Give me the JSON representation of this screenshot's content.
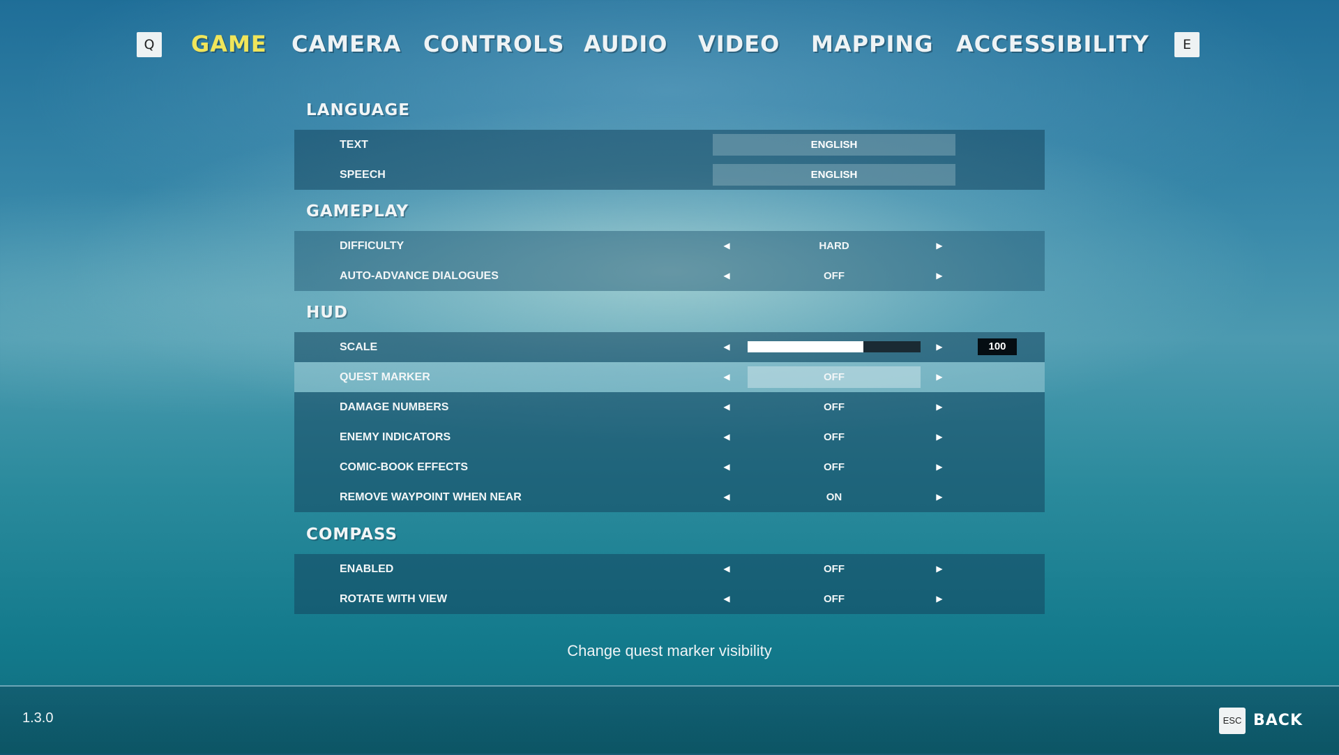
{
  "tabs": {
    "prev_key": "Q",
    "next_key": "E",
    "items": [
      {
        "label": "GAME",
        "active": true
      },
      {
        "label": "CAMERA",
        "active": false
      },
      {
        "label": "CONTROLS",
        "active": false
      },
      {
        "label": "AUDIO",
        "active": false
      },
      {
        "label": "VIDEO",
        "active": false
      },
      {
        "label": "MAPPING",
        "active": false
      },
      {
        "label": "ACCESSIBILITY",
        "active": false
      }
    ]
  },
  "sections": {
    "language": {
      "title": "LANGUAGE",
      "rows": [
        {
          "label": "TEXT",
          "value": "ENGLISH"
        },
        {
          "label": "SPEECH",
          "value": "ENGLISH"
        }
      ]
    },
    "gameplay": {
      "title": "GAMEPLAY",
      "rows": [
        {
          "label": "DIFFICULTY",
          "value": "HARD"
        },
        {
          "label": "AUTO-ADVANCE DIALOGUES",
          "value": "OFF"
        }
      ]
    },
    "hud": {
      "title": "HUD",
      "scale": {
        "label": "SCALE",
        "value": "100",
        "fill_fraction": 0.67
      },
      "rows": [
        {
          "label": "QUEST MARKER",
          "value": "OFF",
          "selected": true
        },
        {
          "label": "DAMAGE NUMBERS",
          "value": "OFF"
        },
        {
          "label": "ENEMY INDICATORS",
          "value": "OFF"
        },
        {
          "label": "COMIC-BOOK EFFECTS",
          "value": "OFF"
        },
        {
          "label": "REMOVE WAYPOINT WHEN NEAR",
          "value": "ON"
        }
      ]
    },
    "compass": {
      "title": "COMPASS",
      "rows": [
        {
          "label": "ENABLED",
          "value": "OFF"
        },
        {
          "label": "ROTATE WITH VIEW",
          "value": "OFF"
        }
      ]
    }
  },
  "description": "Change quest marker visibility",
  "footer": {
    "version": "1.3.0",
    "back_key": "ESC",
    "back_label": "BACK"
  },
  "icons": {
    "left": "arrow-left-icon",
    "right": "arrow-right-icon"
  },
  "colors": {
    "active_tab": "#f0e55a",
    "selected_row": "#a9d1db"
  }
}
